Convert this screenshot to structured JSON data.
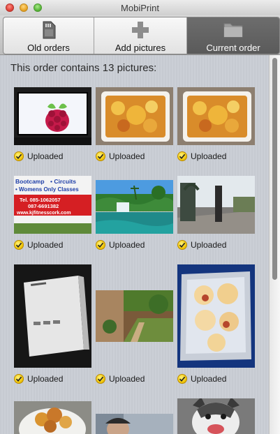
{
  "window": {
    "title": "MobiPrint"
  },
  "toolbar": {
    "buttons": [
      {
        "label": "Old orders",
        "icon": "sd-card-icon",
        "active": false
      },
      {
        "label": "Add pictures",
        "icon": "plus-icon",
        "active": false
      },
      {
        "label": "Current order",
        "icon": "folder-icon",
        "active": true
      }
    ]
  },
  "order": {
    "heading": "This order contains 13 pictures:",
    "pictures": [
      {
        "status": "Uploaded",
        "subject": "raspberry-pi-logo-on-screen"
      },
      {
        "status": "Uploaded",
        "subject": "baked-dish"
      },
      {
        "status": "Uploaded",
        "subject": "baked-dish"
      },
      {
        "status": "Uploaded",
        "subject": "bootcamp-circuits-sign"
      },
      {
        "status": "Uploaded",
        "subject": "waterfall-landscape"
      },
      {
        "status": "Uploaded",
        "subject": "street-scene"
      },
      {
        "status": "Uploaded",
        "subject": "device-box"
      },
      {
        "status": "Uploaded",
        "subject": "garden-steps"
      },
      {
        "status": "Uploaded",
        "subject": "roasted-chicken-tray"
      },
      {
        "status": "",
        "subject": "fried-food"
      },
      {
        "status": "",
        "subject": "person-portrait"
      },
      {
        "status": "",
        "subject": "smiling-dog"
      }
    ],
    "sign_text": [
      "Bootcamp",
      "• Circuits",
      "• Womens Only Classes",
      "Tel. 085-1062057",
      "087-6691382",
      "www.kjfitnesscork.com"
    ]
  },
  "colors": {
    "active_tab": "#5f5f5f",
    "check_badge": "#f2c90c",
    "content_bg": "#c8ccd3"
  }
}
